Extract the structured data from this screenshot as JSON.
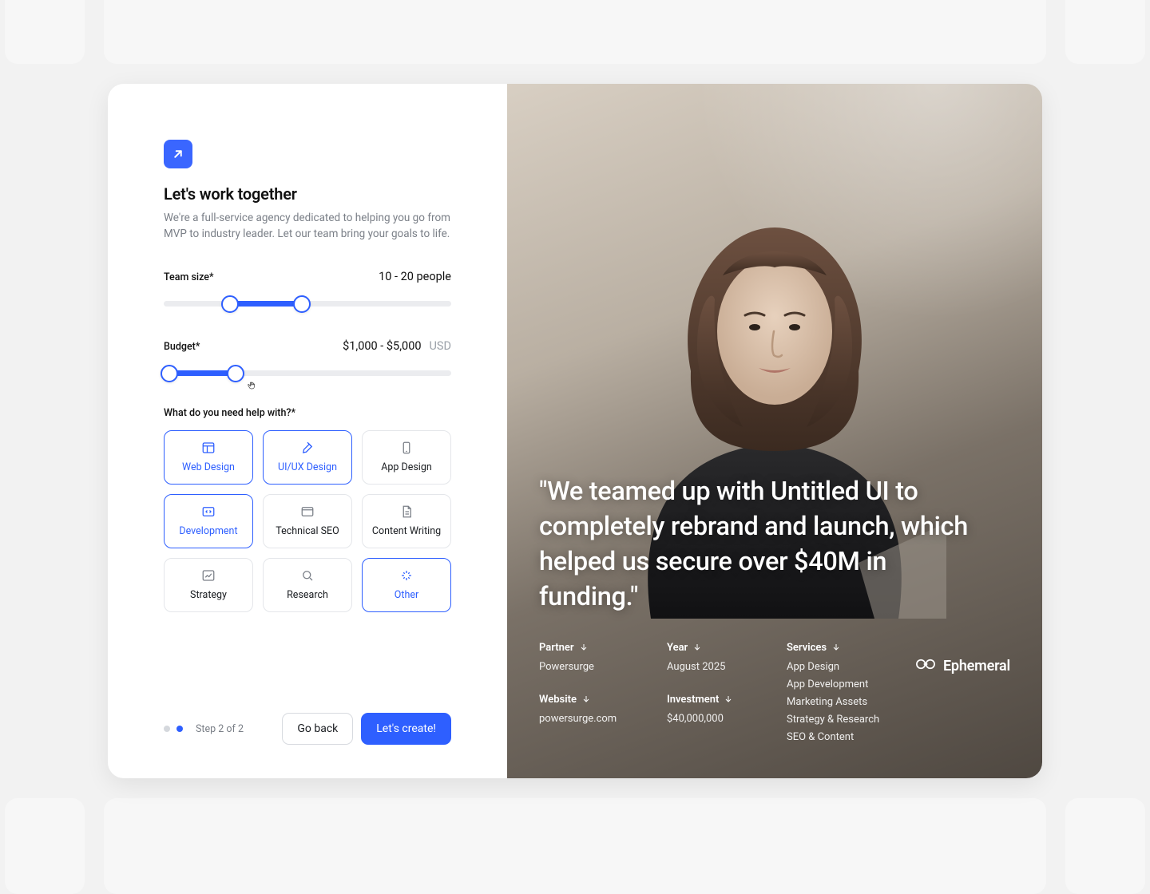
{
  "header": {
    "title": "Let's work together",
    "subtitle": "We're a full-service agency dedicated to helping you go from MVP to industry leader. Let our team bring your goals to life."
  },
  "team_size": {
    "label": "Team size*",
    "value_text": "10 - 20 people",
    "min_pct": 23,
    "max_pct": 48
  },
  "budget": {
    "label": "Budget*",
    "value_text": "$1,000 - $5,000",
    "unit": "USD",
    "min_pct": 2,
    "max_pct": 25
  },
  "help": {
    "label": "What do you need help with?*",
    "tiles": [
      {
        "icon": "layout-icon",
        "label": "Web Design",
        "active": true
      },
      {
        "icon": "pen-icon",
        "label": "UI/UX Design",
        "active": true
      },
      {
        "icon": "phone-icon",
        "label": "App Design",
        "active": false
      },
      {
        "icon": "code-icon",
        "label": "Development",
        "active": true
      },
      {
        "icon": "browser-icon",
        "label": "Technical SEO",
        "active": false
      },
      {
        "icon": "doc-icon",
        "label": "Content Writing",
        "active": false
      },
      {
        "icon": "chart-icon",
        "label": "Strategy",
        "active": false
      },
      {
        "icon": "search-icon",
        "label": "Research",
        "active": false
      },
      {
        "icon": "sparkle-icon",
        "label": "Other",
        "active": true
      }
    ]
  },
  "footer": {
    "step_text": "Step 2 of 2",
    "back_label": "Go back",
    "create_label": "Let's create!"
  },
  "testimonial": {
    "quote": "\"We teamed up with Untitled UI to completely rebrand and launch, which helped us secure over $40M in funding.\"",
    "brand_name": "Ephemeral",
    "meta": {
      "partner_key": "Partner",
      "partner_val": "Powersurge",
      "website_key": "Website",
      "website_val": "powersurge.com",
      "year_key": "Year",
      "year_val": "August 2025",
      "investment_key": "Investment",
      "investment_val": "$40,000,000",
      "services_key": "Services",
      "services": [
        "App Design",
        "App Development",
        "Marketing Assets",
        "Strategy & Research",
        "SEO & Content"
      ]
    }
  }
}
